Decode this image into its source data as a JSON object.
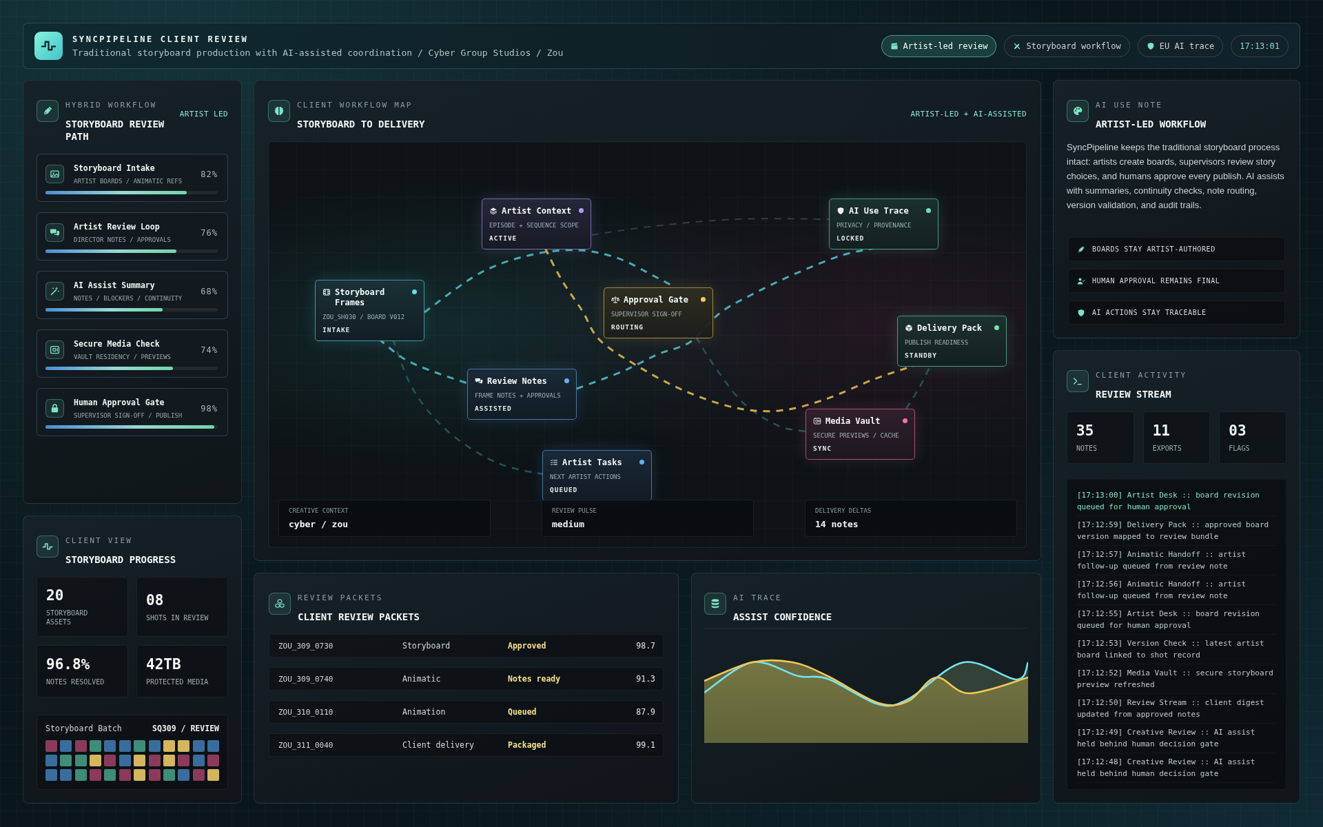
{
  "header": {
    "title": "SYNCPIPELINE CLIENT REVIEW",
    "subtitle": "Traditional storyboard production with AI-assisted coordination / Cyber Group Studios / Zou",
    "chips": [
      {
        "label": "Artist-led review",
        "active": true
      },
      {
        "label": "Storyboard workflow",
        "active": false
      },
      {
        "label": "EU AI trace",
        "active": false
      }
    ],
    "clock": "17:13:01"
  },
  "hybrid_workflow": {
    "eyebrow": "HYBRID WORKFLOW",
    "title": "STORYBOARD REVIEW PATH",
    "tag": "ARTIST LED",
    "steps": [
      {
        "title": "Storyboard Intake",
        "detail": "ARTIST BOARDS / ANIMATIC REFS",
        "reading": "82%",
        "level": 0.82
      },
      {
        "title": "Artist Review Loop",
        "detail": "DIRECTOR NOTES / APPROVALS",
        "reading": "76%",
        "level": 0.76
      },
      {
        "title": "AI Assist Summary",
        "detail": "NOTES / BLOCKERS / CONTINUITY",
        "reading": "68%",
        "level": 0.68
      },
      {
        "title": "Secure Media Check",
        "detail": "VAULT RESIDENCY / PREVIEWS",
        "reading": "74%",
        "level": 0.74
      },
      {
        "title": "Human Approval Gate",
        "detail": "SUPERVISOR SIGN-OFF / PUBLISH",
        "reading": "98%",
        "level": 0.98
      }
    ]
  },
  "client_view": {
    "eyebrow": "CLIENT VIEW",
    "title": "STORYBOARD PROGRESS",
    "stats": [
      {
        "value": "20",
        "label": "STORYBOARD ASSETS"
      },
      {
        "value": "08",
        "label": "SHOTS IN REVIEW"
      },
      {
        "value": "96.8%",
        "label": "NOTES RESOLVED"
      },
      {
        "value": "42TB",
        "label": "PROTECTED MEDIA"
      }
    ],
    "batch": {
      "label": "Storyboard Batch",
      "tag": "SQ309 / REVIEW",
      "cells": [
        {
          "color": "#8b3a5c"
        },
        {
          "color": "#3a6d9c"
        },
        {
          "color": "#8b3a5c"
        },
        {
          "color": "#3f8c78"
        },
        {
          "color": "#3a6d9c"
        },
        {
          "color": "#3a6d9c"
        },
        {
          "color": "#3f8c78"
        },
        {
          "color": "#3a6d9c"
        },
        {
          "color": "#d5b55e"
        },
        {
          "color": "#d5b55e"
        },
        {
          "color": "#3a6d9c"
        },
        {
          "color": "#3a6d9c"
        },
        {
          "color": "#3a6d9c"
        },
        {
          "color": "#3f8c78"
        },
        {
          "color": "#3f8c78"
        },
        {
          "color": "#d5b55e"
        },
        {
          "color": "#8b3a5c"
        },
        {
          "color": "#3a6d9c"
        },
        {
          "color": "#d5b55e"
        },
        {
          "color": "#8b3a5c"
        },
        {
          "color": "#d5b55e"
        },
        {
          "color": "#8b3a5c"
        },
        {
          "color": "#3a6d9c"
        },
        {
          "color": "#8b3a5c"
        },
        {
          "color": "#3a6d9c"
        },
        {
          "color": "#3a6d9c"
        },
        {
          "color": "#3f8c78"
        },
        {
          "color": "#8b3a5c"
        },
        {
          "color": "#3f8c78"
        },
        {
          "color": "#8b3a5c"
        },
        {
          "color": "#d5b55e"
        },
        {
          "color": "#8b3a5c"
        },
        {
          "color": "#3f8c78"
        },
        {
          "color": "#3a6d9c"
        },
        {
          "color": "#8b3a5c"
        },
        {
          "color": "#d5b55e"
        }
      ]
    }
  },
  "workflow_map": {
    "eyebrow": "CLIENT WORKFLOW MAP",
    "title": "STORYBOARD TO DELIVERY",
    "tag": "ARTIST-LED + AI-ASSISTED",
    "nodes": [
      {
        "title": "Artist Context",
        "detail": "EPISODE + SEQUENCE SCOPE",
        "status": "ACTIVE",
        "color": "#b49cff"
      },
      {
        "title": "AI Use Trace",
        "detail": "PRIVACY / PROVENANCE",
        "status": "LOCKED",
        "color": "#6fe3b4"
      },
      {
        "title": "Storyboard Frames",
        "detail": "ZOU_SH030 / BOARD V012",
        "status": "INTAKE",
        "color": "#63dcec"
      },
      {
        "title": "Approval Gate",
        "detail": "SUPERVISOR SIGN-OFF",
        "status": "ROUTING",
        "color": "#f4c95d"
      },
      {
        "title": "Delivery Pack",
        "detail": "PUBLISH READINESS",
        "status": "STANDBY",
        "color": "#6fe3b4"
      },
      {
        "title": "Review Notes",
        "detail": "FRAME NOTES + APPROVALS",
        "status": "ASSISTED",
        "color": "#66aef5"
      },
      {
        "title": "Media Vault",
        "detail": "SECURE PREVIEWS / CACHE",
        "status": "SYNC",
        "color": "#ff6fa8"
      },
      {
        "title": "Artist Tasks",
        "detail": "NEXT ARTIST ACTIONS",
        "status": "QUEUED",
        "color": "#66aef5"
      }
    ],
    "summary": [
      {
        "label": "CREATIVE CONTEXT",
        "value": "cyber / zou"
      },
      {
        "label": "REVIEW PULSE",
        "value": "medium"
      },
      {
        "label": "DELIVERY DELTAS",
        "value": "14 notes"
      }
    ]
  },
  "review_packets": {
    "eyebrow": "REVIEW PACKETS",
    "title": "CLIENT REVIEW PACKETS",
    "rows": [
      {
        "id": "ZOU_309_0730",
        "type": "Storyboard",
        "status": "Approved",
        "score": "98.7"
      },
      {
        "id": "ZOU_309_0740",
        "type": "Animatic",
        "status": "Notes ready",
        "score": "91.3"
      },
      {
        "id": "ZOU_310_0110",
        "type": "Animation",
        "status": "Queued",
        "score": "87.9"
      },
      {
        "id": "ZOU_311_0040",
        "type": "Client delivery",
        "status": "Packaged",
        "score": "99.1"
      }
    ]
  },
  "ai_trace": {
    "eyebrow": "AI TRACE",
    "title": "ASSIST CONFIDENCE"
  },
  "ai_use_note": {
    "eyebrow": "AI USE NOTE",
    "title": "ARTIST-LED WORKFLOW",
    "body": "SyncPipeline keeps the traditional storyboard process intact: artists create boards, supervisors review story choices, and humans approve every publish. AI assists with summaries, continuity checks, note routing, version validation, and audit trails.",
    "principles": [
      "BOARDS STAY ARTIST-AUTHORED",
      "HUMAN APPROVAL REMAINS FINAL",
      "AI ACTIONS STAY TRACEABLE"
    ]
  },
  "client_activity": {
    "eyebrow": "CLIENT ACTIVITY",
    "title": "REVIEW STREAM",
    "stats": [
      {
        "value": "35",
        "label": "NOTES"
      },
      {
        "value": "11",
        "label": "EXPORTS"
      },
      {
        "value": "03",
        "label": "FLAGS"
      }
    ],
    "log": [
      {
        "text": "[17:13:00] Artist Desk :: board revision queued for human approval",
        "highlighted": true
      },
      {
        "text": "[17:12:59] Delivery Pack :: approved board version mapped to review bundle",
        "highlighted": false
      },
      {
        "text": "[17:12:57] Animatic Handoff :: artist follow-up queued from review note",
        "highlighted": false
      },
      {
        "text": "[17:12:56] Animatic Handoff :: artist follow-up queued from review note",
        "highlighted": false
      },
      {
        "text": "[17:12:55] Artist Desk :: board revision queued for human approval",
        "highlighted": false
      },
      {
        "text": "[17:12:53] Version Check :: latest artist board linked to shot record",
        "highlighted": false
      },
      {
        "text": "[17:12:52] Media Vault :: secure storyboard preview refreshed",
        "highlighted": false
      },
      {
        "text": "[17:12:50] Review Stream :: client digest updated from approved notes",
        "highlighted": false
      },
      {
        "text": "[17:12:49] Creative Review :: AI assist held behind human decision gate",
        "highlighted": false
      },
      {
        "text": "[17:12:48] Creative Review :: AI assist held behind human decision gate",
        "highlighted": false
      }
    ]
  }
}
